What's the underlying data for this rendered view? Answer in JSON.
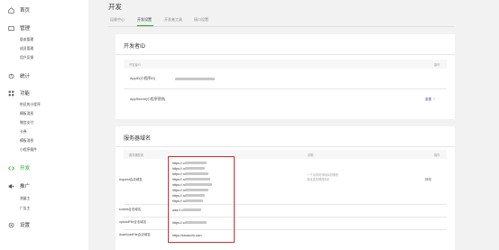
{
  "sidebar": {
    "groups": [
      {
        "label": "首页",
        "icon": "home-icon"
      },
      {
        "label": "管理",
        "icon": "manage-icon"
      },
      {
        "label": "统计",
        "icon": "stats-icon"
      },
      {
        "label": "功能",
        "icon": "function-icon"
      },
      {
        "label": "开发",
        "icon": "dev-icon"
      },
      {
        "label": "推广",
        "icon": "promotion-icon"
      },
      {
        "label": "设置",
        "icon": "settings-icon"
      }
    ],
    "manage_items": [
      "版本管理",
      "成员管理",
      "用户反馈"
    ],
    "function_items": [
      "附近的小程序",
      "模板消息",
      "微信支付",
      "卡券",
      "模板消息",
      "小程序插件"
    ],
    "promo_items": [
      "流量主",
      "广告主"
    ]
  },
  "main": {
    "title": "开发",
    "tabs": [
      {
        "label": "运维中心"
      },
      {
        "label": "开发设置"
      },
      {
        "label": "开发者工具"
      },
      {
        "label": "接口设置"
      }
    ]
  },
  "developer_id": {
    "title": "开发者ID",
    "col_name": "开发者ID",
    "col_action": "操作",
    "rows": [
      {
        "label": "AppID(小程序ID)",
        "action": ""
      },
      {
        "label": "AppSecret(小程序密钥)",
        "action": "重置"
      }
    ],
    "action_extra": "?"
  },
  "server_domain": {
    "title": "服务器域名",
    "col_type": "服务器配置",
    "col_desc": "说明",
    "col_action": "操作",
    "request_label": "request合法域名",
    "request_domains": [
      "https://.com",
      "https://.net",
      "https://.net",
      "https://.net",
      "https://.net",
      "https://.net",
      "https://.net",
      "https://.net"
    ],
    "socket_label": "socket合法域名",
    "socket_domain": "wss://.com",
    "upload_label": "uploadFile合法域名",
    "upload_domain": "https://.com",
    "download_label": "downloadFile合法域名",
    "download_domain": "https://sxcaozin.com",
    "note_line1": "一个月内可申请5次修改",
    "note_line2": "本月还可修改5次",
    "modify": "修改"
  },
  "colors": {
    "accent": "#1aad19",
    "highlight": "#d32f2f",
    "link": "#576b95"
  }
}
